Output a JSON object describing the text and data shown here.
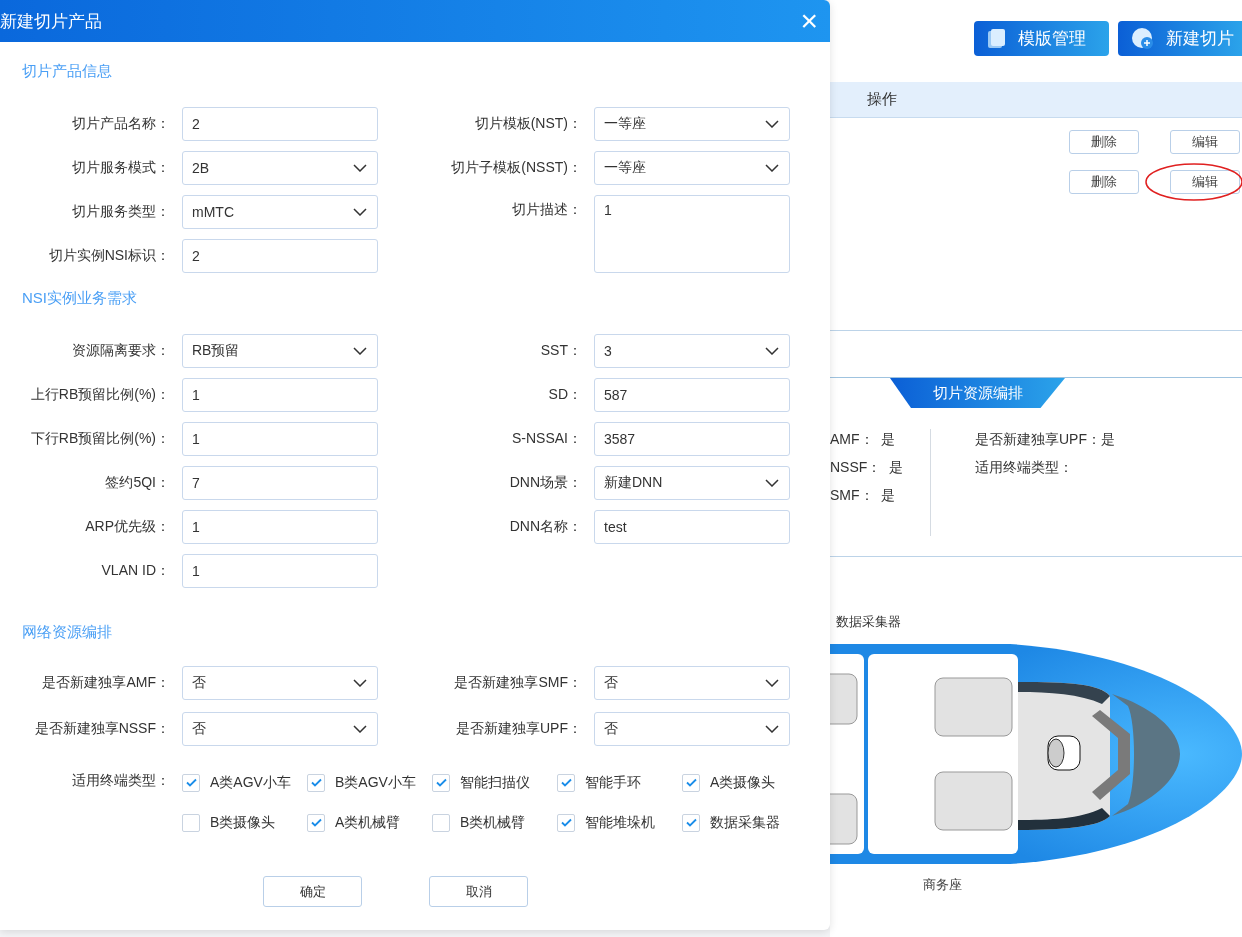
{
  "dialog": {
    "title": "新建切片产品",
    "close": "×",
    "sections": [
      {
        "title": "切片产品信息",
        "left": [
          {
            "label": "切片产品名称：",
            "value": "2",
            "kind": "input"
          },
          {
            "label": "切片服务模式：",
            "value": "2B",
            "kind": "select"
          },
          {
            "label": "切片服务类型：",
            "value": "mMTC",
            "kind": "select"
          },
          {
            "label": "切片实例NSI标识：",
            "value": "2",
            "kind": "input"
          }
        ],
        "right": [
          {
            "label": "切片模板(NST)：",
            "value": "一等座",
            "kind": "select"
          },
          {
            "label": "切片子模板(NSST)：",
            "value": "一等座",
            "kind": "select"
          },
          {
            "label": "切片描述：",
            "value": "1",
            "kind": "textarea"
          }
        ]
      },
      {
        "title": "NSI实例业务需求",
        "left": [
          {
            "label": "资源隔离要求：",
            "value": "RB预留",
            "kind": "select"
          },
          {
            "label": "上行RB预留比例(%)：",
            "value": "1",
            "kind": "input"
          },
          {
            "label": "下行RB预留比例(%)：",
            "value": "1",
            "kind": "input"
          },
          {
            "label": "签约5QI：",
            "value": "7",
            "kind": "input"
          },
          {
            "label": "ARP优先级：",
            "value": "1",
            "kind": "input"
          },
          {
            "label": "VLAN ID：",
            "value": "1",
            "kind": "input"
          }
        ],
        "right": [
          {
            "label": "SST：",
            "value": "3",
            "kind": "select"
          },
          {
            "label": "SD：",
            "value": "587",
            "kind": "input"
          },
          {
            "label": "S-NSSAI：",
            "value": "3587",
            "kind": "input"
          },
          {
            "label": "DNN场景：",
            "value": "新建DNN",
            "kind": "select"
          },
          {
            "label": "DNN名称：",
            "value": "test",
            "kind": "input"
          }
        ]
      },
      {
        "title": "网络资源编排",
        "left": [
          {
            "label": "是否新建独享AMF：",
            "value": "否",
            "kind": "select"
          },
          {
            "label": "是否新建独享NSSF：",
            "value": "否",
            "kind": "select"
          }
        ],
        "right": [
          {
            "label": "是否新建独享SMF：",
            "value": "否",
            "kind": "select"
          },
          {
            "label": "是否新建独享UPF：",
            "value": "否",
            "kind": "select"
          }
        ],
        "terminal_types": {
          "label": "适用终端类型：",
          "options": [
            {
              "label": "A类AGV小车",
              "checked": true
            },
            {
              "label": "B类AGV小车",
              "checked": true
            },
            {
              "label": "智能扫描仪",
              "checked": true
            },
            {
              "label": "智能手环",
              "checked": true
            },
            {
              "label": "A类摄像头",
              "checked": true
            },
            {
              "label": "B类摄像头",
              "checked": false
            },
            {
              "label": "A类机械臂",
              "checked": true
            },
            {
              "label": "B类机械臂",
              "checked": false
            },
            {
              "label": "智能堆垛机",
              "checked": true
            },
            {
              "label": "数据采集器",
              "checked": true
            }
          ]
        }
      }
    ],
    "buttons": [
      "确定",
      "取消"
    ]
  },
  "background": {
    "buttons": [
      {
        "label": "模版管理",
        "kind": "template"
      },
      {
        "label": "新建切片",
        "kind": "create"
      }
    ],
    "table": {
      "columns": [
        "操作"
      ],
      "rows": [
        {
          "actions": [
            {
              "label": "删除",
              "circled": false
            },
            {
              "label": "编辑",
              "circled": false
            }
          ]
        },
        {
          "actions": [
            {
              "label": "删除",
              "circled": false
            },
            {
              "label": "编辑",
              "circled": true
            }
          ]
        }
      ]
    },
    "resource_tab": "切片资源编排",
    "left_items": [
      {
        "label": "AMF：",
        "value": "是"
      },
      {
        "label": "NSSF：",
        "value": "是"
      },
      {
        "label": "SMF：",
        "value": "是"
      }
    ],
    "right_items": [
      {
        "label": "是否新建独享UPF：",
        "value": "是"
      },
      {
        "label": "适用终端类型："
      }
    ],
    "device_label": "数据采集器",
    "seat_label": "商务座"
  }
}
